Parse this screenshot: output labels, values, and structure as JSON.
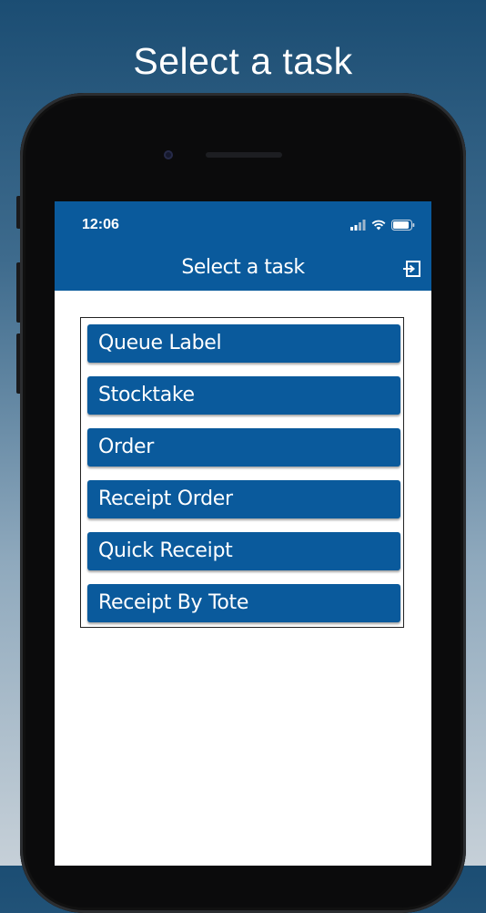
{
  "promo": {
    "title": "Select a task"
  },
  "status_bar": {
    "time": "12:06",
    "icons": [
      "signal-icon",
      "wifi-icon",
      "battery-icon"
    ]
  },
  "nav": {
    "title": "Select a task",
    "logout_icon": "logout-icon"
  },
  "tasks": [
    {
      "label": "Queue Label"
    },
    {
      "label": "Stocktake"
    },
    {
      "label": "Order"
    },
    {
      "label": "Receipt Order"
    },
    {
      "label": "Quick Receipt"
    },
    {
      "label": "Receipt By Tote"
    }
  ],
  "colors": {
    "header": "#0a5a9c",
    "button": "#0a5a9c",
    "button_text": "#ffffff",
    "background_top": "#1b4d73"
  }
}
